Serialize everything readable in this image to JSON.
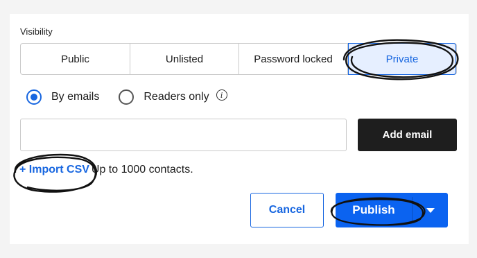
{
  "visibility": {
    "label": "Visibility",
    "options": [
      {
        "label": "Public",
        "active": false
      },
      {
        "label": "Unlisted",
        "active": false
      },
      {
        "label": "Password locked",
        "active": false
      },
      {
        "label": "Private",
        "active": true
      }
    ]
  },
  "audience": {
    "options": [
      {
        "label": "By emails",
        "selected": true
      },
      {
        "label": "Readers only",
        "selected": false
      }
    ],
    "info_icon": "info-icon"
  },
  "email": {
    "value": "",
    "placeholder": "",
    "add_label": "Add email"
  },
  "import": {
    "link_label": "+ Import CSV",
    "hint": "Up to 1000 contacts."
  },
  "actions": {
    "cancel_label": "Cancel",
    "publish_label": "Publish",
    "dropdown_icon": "caret-down-icon"
  },
  "colors": {
    "accent": "#0b63f0",
    "active_bg": "#e6efff",
    "dark_button": "#1e1e1e"
  }
}
